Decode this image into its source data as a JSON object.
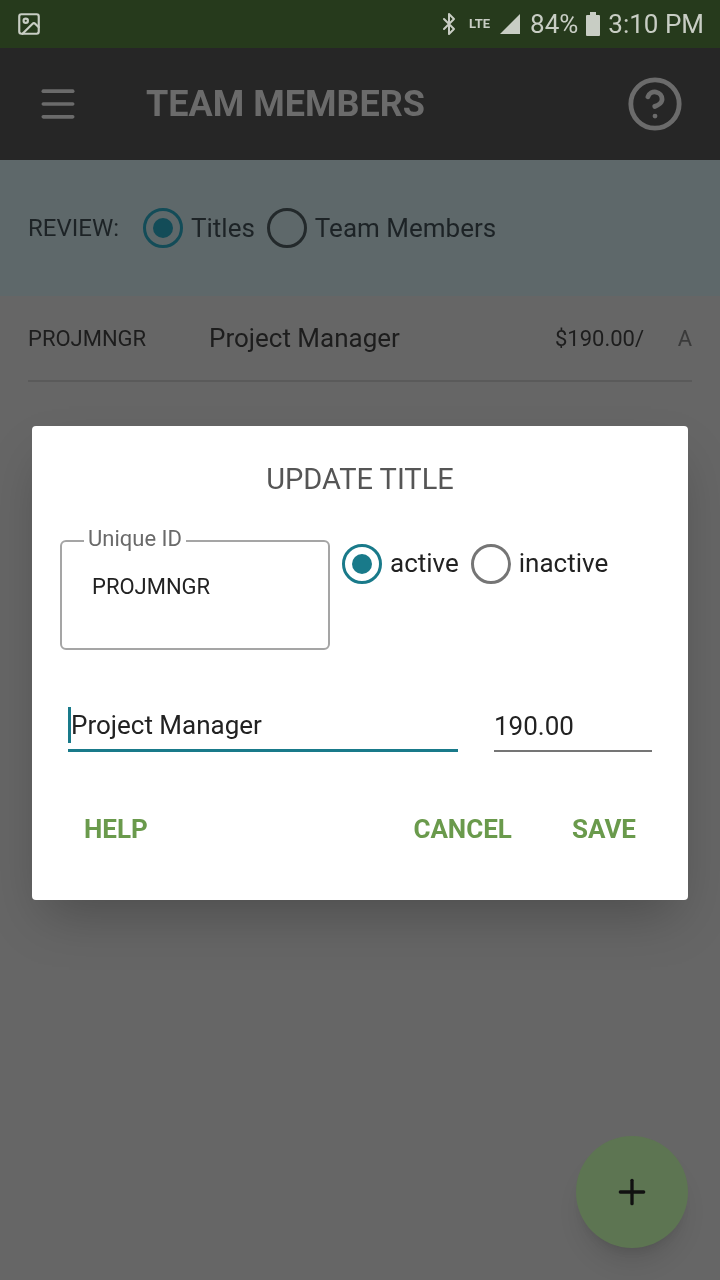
{
  "status_bar": {
    "network": "LTE",
    "battery": "84%",
    "time": "3:10 PM"
  },
  "app_bar": {
    "title": "TEAM MEMBERS"
  },
  "review": {
    "label": "REVIEW:",
    "options": [
      {
        "label": "Titles",
        "selected": true
      },
      {
        "label": "Team Members",
        "selected": false
      }
    ]
  },
  "rows": [
    {
      "code": "PROJMNGR",
      "title": "Project Manager",
      "rate": "$190.00/",
      "status": "A"
    }
  ],
  "dialog": {
    "title": "UPDATE TITLE",
    "id_field": {
      "label": "Unique ID",
      "value": "PROJMNGR"
    },
    "status_options": [
      {
        "label": "active",
        "selected": true
      },
      {
        "label": "inactive",
        "selected": false
      }
    ],
    "name_field": {
      "value": "Project Manager"
    },
    "rate_field": {
      "value": "190.00"
    },
    "buttons": [
      "HELP",
      "CANCEL",
      "SAVE"
    ]
  }
}
